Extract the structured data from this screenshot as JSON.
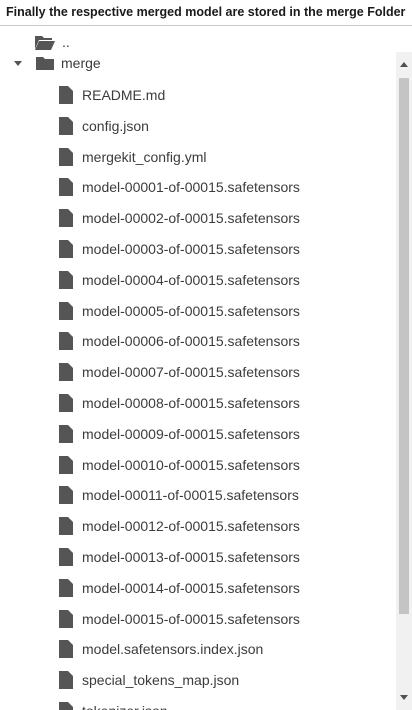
{
  "caption": "Finally the respective merged model are stored in the merge Folder",
  "tree": {
    "parent": {
      "label": "..",
      "icon": "folder-open-icon"
    },
    "folder": {
      "label": "merge",
      "icon": "folder-icon",
      "expanded": true,
      "toggle_icon": "caret-down-icon"
    },
    "files": [
      "README.md",
      "config.json",
      "mergekit_config.yml",
      "model-00001-of-00015.safetensors",
      "model-00002-of-00015.safetensors",
      "model-00003-of-00015.safetensors",
      "model-00004-of-00015.safetensors",
      "model-00005-of-00015.safetensors",
      "model-00006-of-00015.safetensors",
      "model-00007-of-00015.safetensors",
      "model-00008-of-00015.safetensors",
      "model-00009-of-00015.safetensors",
      "model-00010-of-00015.safetensors",
      "model-00011-of-00015.safetensors",
      "model-00012-of-00015.safetensors",
      "model-00013-of-00015.safetensors",
      "model-00014-of-00015.safetensors",
      "model-00015-of-00015.safetensors",
      "model.safetensors.index.json",
      "special_tokens_map.json",
      "tokenizer.json"
    ],
    "file_icon": "file-icon"
  },
  "scrollbar": {
    "up_icon": "arrow-up-icon",
    "down_icon": "arrow-down-icon"
  },
  "colors": {
    "icon": "#555555",
    "text": "#3c3c3c",
    "scroll_thumb": "#c4c4c4"
  }
}
